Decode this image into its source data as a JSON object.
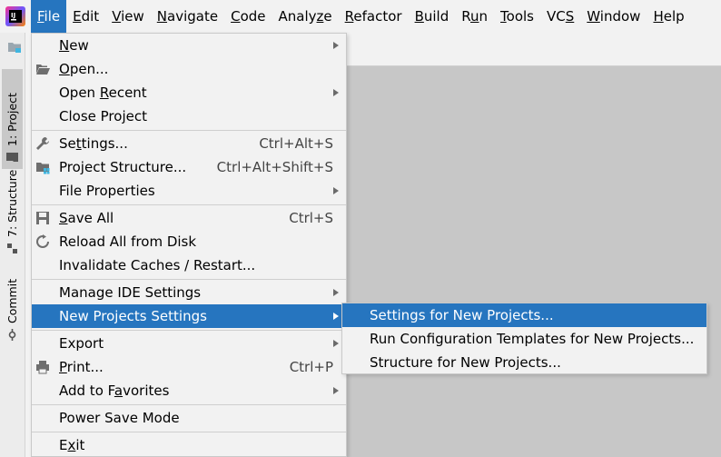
{
  "menubar": {
    "items": [
      {
        "pre": "",
        "mn": "F",
        "post": "ile",
        "active": true
      },
      {
        "pre": "",
        "mn": "E",
        "post": "dit"
      },
      {
        "pre": "",
        "mn": "V",
        "post": "iew"
      },
      {
        "pre": "",
        "mn": "N",
        "post": "avigate"
      },
      {
        "pre": "",
        "mn": "C",
        "post": "ode"
      },
      {
        "pre": "Analy",
        "mn": "z",
        "post": "e"
      },
      {
        "pre": "",
        "mn": "R",
        "post": "efactor"
      },
      {
        "pre": "",
        "mn": "B",
        "post": "uild"
      },
      {
        "pre": "R",
        "mn": "u",
        "post": "n"
      },
      {
        "pre": "",
        "mn": "T",
        "post": "ools"
      },
      {
        "pre": "VC",
        "mn": "S",
        "post": ""
      },
      {
        "pre": "",
        "mn": "W",
        "post": "indow"
      },
      {
        "pre": "",
        "mn": "H",
        "post": "elp"
      }
    ]
  },
  "toolstrip": {
    "project_tab": "1: Project",
    "structure_tab": "7: Structure",
    "commit_tab": "Commit"
  },
  "file_menu": {
    "new": {
      "pre": "",
      "mn": "N",
      "post": "ew"
    },
    "open": {
      "pre": "",
      "mn": "O",
      "post": "pen..."
    },
    "open_recent": {
      "pre": "Open ",
      "mn": "R",
      "post": "ecent"
    },
    "close_project": {
      "pre": "Close Pro",
      "mn": "j",
      "post": "ect"
    },
    "settings": {
      "pre": "Se",
      "mn": "t",
      "post": "tings...",
      "shortcut": "Ctrl+Alt+S"
    },
    "project_structure": {
      "pre": "Project Structure...",
      "mn": "",
      "post": "",
      "shortcut": "Ctrl+Alt+Shift+S"
    },
    "file_properties": {
      "pre": "File Properties",
      "mn": "",
      "post": ""
    },
    "save_all": {
      "pre": "",
      "mn": "S",
      "post": "ave All",
      "shortcut": "Ctrl+S"
    },
    "reload": {
      "pre": "Reload All from Disk",
      "mn": "",
      "post": ""
    },
    "invalidate": {
      "pre": "Invalidate Caches / Restart...",
      "mn": "",
      "post": ""
    },
    "manage_ide": {
      "pre": "Manage IDE Settings",
      "mn": "",
      "post": ""
    },
    "new_projects_settings": {
      "pre": "New Projects Settings",
      "mn": "",
      "post": ""
    },
    "export": {
      "pre": "Export",
      "mn": "",
      "post": ""
    },
    "print": {
      "pre": "",
      "mn": "P",
      "post": "rint...",
      "shortcut": "Ctrl+P"
    },
    "add_favorites": {
      "pre": "Add to F",
      "mn": "a",
      "post": "vorites"
    },
    "power_save": {
      "pre": "Power Save Mode",
      "mn": "",
      "post": ""
    },
    "exit": {
      "pre": "E",
      "mn": "x",
      "post": "it"
    }
  },
  "submenu": {
    "settings_new": "Settings for New Projects...",
    "run_templates": "Run Configuration Templates for New Projects...",
    "structure_new": "Structure for New Projects..."
  },
  "colors": {
    "highlight": "#2675bf",
    "menu_bg": "#f2f2f2",
    "editor_bg": "#c7c7c7"
  }
}
